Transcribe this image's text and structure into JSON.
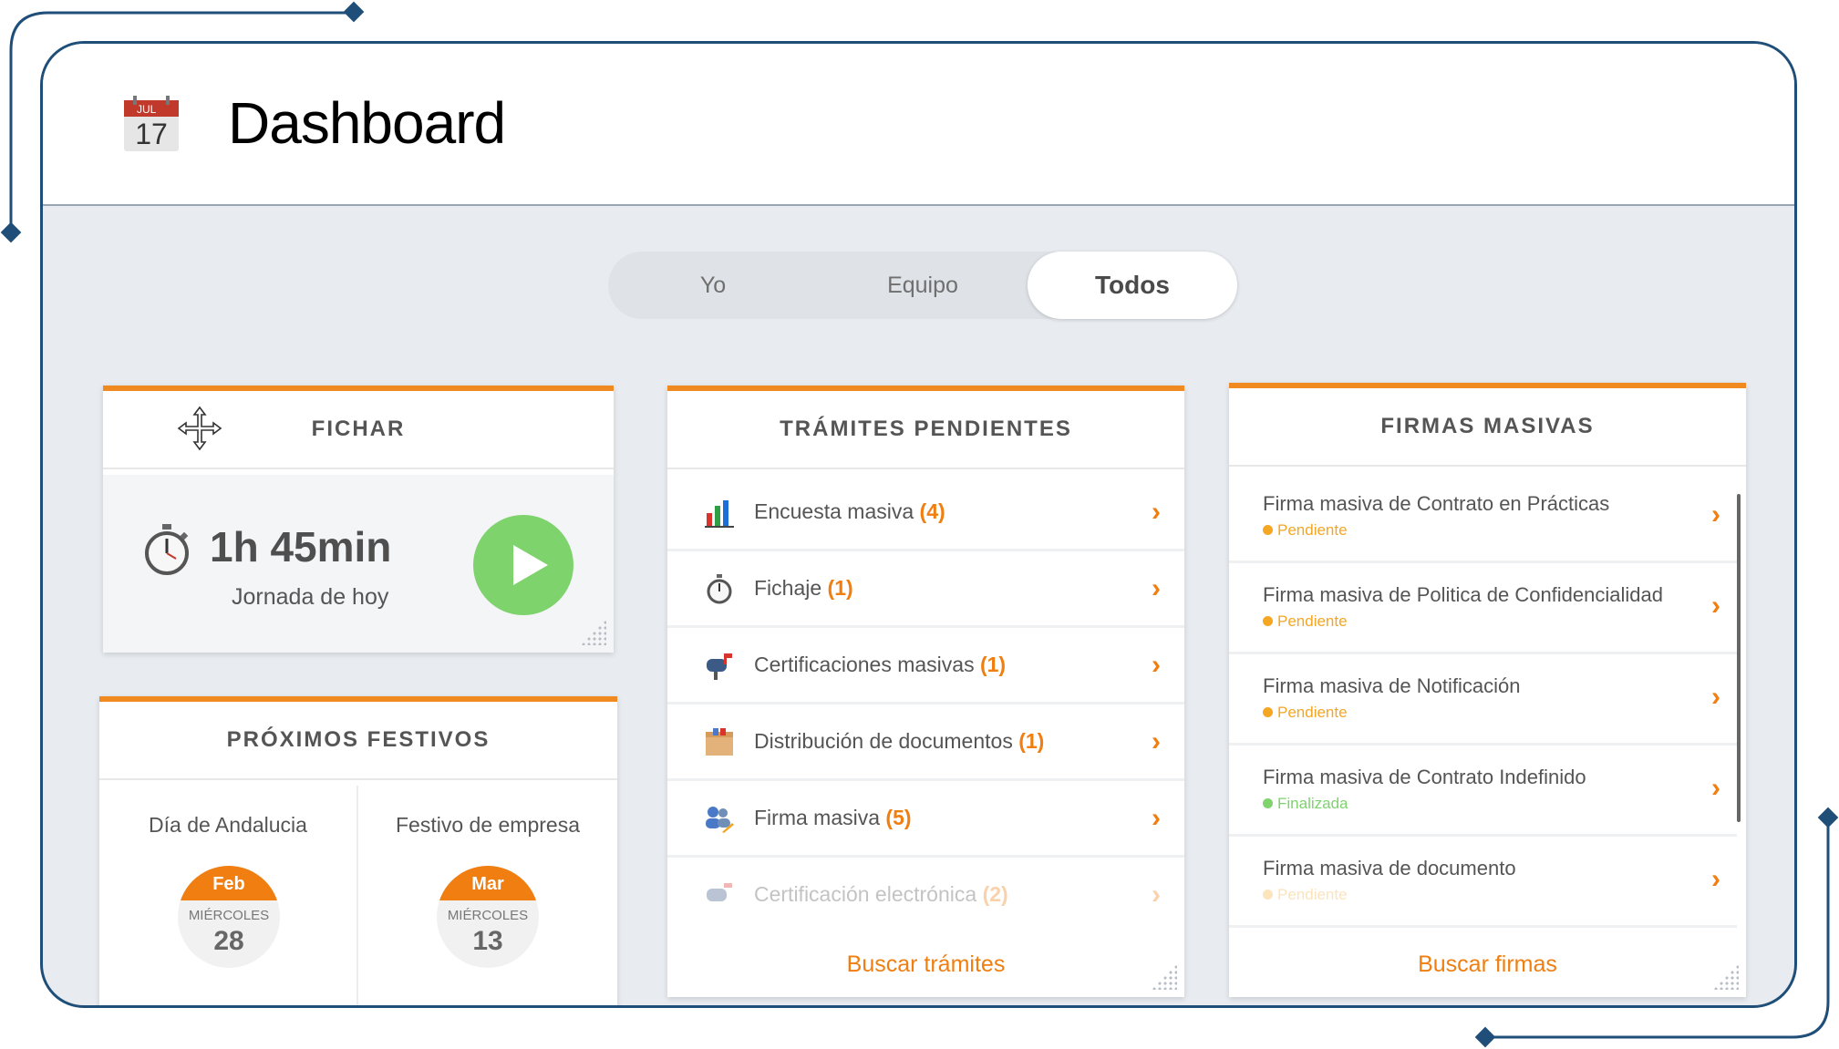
{
  "header": {
    "title": "Dashboard",
    "calendar_icon": {
      "month": "JUL",
      "day": "17"
    }
  },
  "tabs": [
    {
      "label": "Yo",
      "active": false
    },
    {
      "label": "Equipo",
      "active": false
    },
    {
      "label": "Todos",
      "active": true
    }
  ],
  "fichar": {
    "title": "FICHAR",
    "time": "1h 45min",
    "subtitle": "Jornada de hoy"
  },
  "festivos": {
    "title": "PRÓXIMOS FESTIVOS",
    "items": [
      {
        "name": "Día de Andalucia",
        "month": "Feb",
        "weekday": "MIÉRCOLES",
        "day": "28"
      },
      {
        "name": "Festivo de empresa",
        "month": "Mar",
        "weekday": "MIÉRCOLES",
        "day": "13"
      }
    ]
  },
  "tramites": {
    "title": "TRÁMITES PENDIENTES",
    "items": [
      {
        "label": "Encuesta masiva",
        "count": "(4)",
        "icon": "bar-chart-icon"
      },
      {
        "label": "Fichaje",
        "count": "(1)",
        "icon": "stopwatch-icon"
      },
      {
        "label": "Certificaciones masivas",
        "count": "(1)",
        "icon": "mailbox-icon"
      },
      {
        "label": "Distribución de documentos",
        "count": "(1)",
        "icon": "box-icon"
      },
      {
        "label": "Firma masiva",
        "count": "(5)",
        "icon": "users-sign-icon"
      },
      {
        "label": "Certificación electrónica",
        "count": "(2)",
        "icon": "certificate-icon"
      }
    ],
    "footer": "Buscar trámites"
  },
  "firmas": {
    "title": "FIRMAS MASIVAS",
    "items": [
      {
        "title": "Firma masiva de Contrato en Prácticas",
        "status": "Pendiente",
        "status_color": "#f5a623"
      },
      {
        "title": "Firma masiva de Politica de Confidencialidad",
        "status": "Pendiente",
        "status_color": "#f5a623"
      },
      {
        "title": "Firma masiva de Notificación",
        "status": "Pendiente",
        "status_color": "#f5a623"
      },
      {
        "title": "Firma masiva de Contrato Indefinido",
        "status": "Finalizada",
        "status_color": "#7ed36d"
      },
      {
        "title": "Firma masiva de documento",
        "status": "Pendiente",
        "status_color": "#f5a623"
      }
    ],
    "footer": "Buscar firmas"
  },
  "colors": {
    "accent": "#f07e10",
    "frame": "#1f4e79",
    "play": "#7ed36d"
  }
}
